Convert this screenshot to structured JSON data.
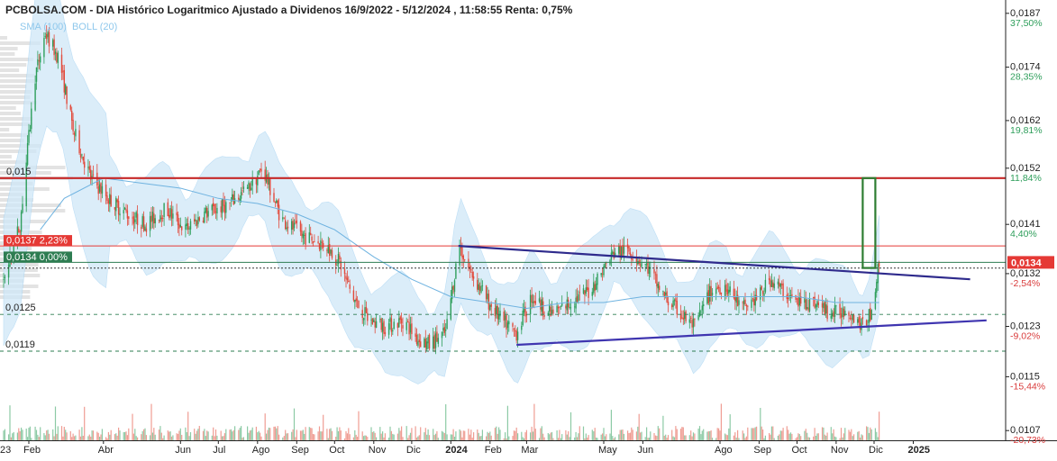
{
  "chart_data": {
    "type": "candlestick",
    "title": "PCBOLSA.COM - DIA Histórico Logaritmico Ajustado a Dividenos 16/9/2022 - 5/12/2024 , 11:58:55 Renta: 0,75%",
    "legend": [
      "SMA (100)",
      "BOLL (20)"
    ],
    "y_scale": "log",
    "ylim": [
      0.0106,
      0.0189
    ],
    "y_ticks": [
      {
        "value": 0.0187,
        "label": "0,0187",
        "pct": "37,50%"
      },
      {
        "value": 0.0174,
        "label": "0,0174",
        "pct": "28,35%"
      },
      {
        "value": 0.0162,
        "label": "0,0162",
        "pct": "19,81%"
      },
      {
        "value": 0.0152,
        "label": "0,0152",
        "pct": "11,84%"
      },
      {
        "value": 0.0141,
        "label": "0,0141",
        "pct": "4,40%"
      },
      {
        "value": 0.0132,
        "label": "0,0132",
        "pct": "-2,54%"
      },
      {
        "value": 0.0123,
        "label": "0,0123",
        "pct": "-9,02%"
      },
      {
        "value": 0.0115,
        "label": "0,0115",
        "pct": "-15,44%"
      },
      {
        "value": 0.0107,
        "label": "0,0107",
        "pct": "-20,73%"
      }
    ],
    "x_range": [
      "2023-01-12",
      "2025-03-08"
    ],
    "x_ticks": [
      {
        "date": "2023-01-02",
        "label": "23"
      },
      {
        "date": "2023-02-01",
        "label": "Feb"
      },
      {
        "date": "2023-04-01",
        "label": "Abr"
      },
      {
        "date": "2023-06-01",
        "label": "Jun"
      },
      {
        "date": "2023-07-01",
        "label": "Jul"
      },
      {
        "date": "2023-08-01",
        "label": "Ago"
      },
      {
        "date": "2023-09-01",
        "label": "Sep"
      },
      {
        "date": "2023-10-01",
        "label": "Oct"
      },
      {
        "date": "2023-11-01",
        "label": "Nov"
      },
      {
        "date": "2023-12-01",
        "label": "Dic"
      },
      {
        "date": "2024-01-01",
        "label": "2024"
      },
      {
        "date": "2024-02-01",
        "label": "Feb"
      },
      {
        "date": "2024-03-01",
        "label": "Mar"
      },
      {
        "date": "2024-05-01",
        "label": "May"
      },
      {
        "date": "2024-06-01",
        "label": "Jun"
      },
      {
        "date": "2024-08-01",
        "label": "Ago"
      },
      {
        "date": "2024-09-01",
        "label": "Sep"
      },
      {
        "date": "2024-10-01",
        "label": "Oct"
      },
      {
        "date": "2024-11-01",
        "label": "Nov"
      },
      {
        "date": "2024-12-01",
        "label": "Dic"
      },
      {
        "date": "2025-01-01",
        "label": "2025"
      }
    ],
    "price_path": [
      [
        "2023-01-12",
        0.0131
      ],
      [
        "2023-01-25",
        0.0141
      ],
      [
        "2023-02-06",
        0.0172
      ],
      [
        "2023-02-14",
        0.0182
      ],
      [
        "2023-02-25",
        0.0176
      ],
      [
        "2023-03-08",
        0.016
      ],
      [
        "2023-03-22",
        0.015
      ],
      [
        "2023-04-05",
        0.0146
      ],
      [
        "2023-04-20",
        0.0143
      ],
      [
        "2023-05-05",
        0.0141
      ],
      [
        "2023-05-20",
        0.0144
      ],
      [
        "2023-06-05",
        0.014
      ],
      [
        "2023-06-20",
        0.0143
      ],
      [
        "2023-07-10",
        0.0145
      ],
      [
        "2023-07-25",
        0.0148
      ],
      [
        "2023-08-05",
        0.0152
      ],
      [
        "2023-08-20",
        0.0142
      ],
      [
        "2023-09-05",
        0.0139
      ],
      [
        "2023-09-25",
        0.0137
      ],
      [
        "2023-10-05",
        0.0134
      ],
      [
        "2023-10-15",
        0.0128
      ],
      [
        "2023-10-28",
        0.0124
      ],
      [
        "2023-11-10",
        0.0123
      ],
      [
        "2023-11-25",
        0.0124
      ],
      [
        "2023-12-05",
        0.0121
      ],
      [
        "2023-12-15",
        0.012
      ],
      [
        "2023-12-28",
        0.0122
      ],
      [
        "2024-01-04",
        0.0132
      ],
      [
        "2024-01-08",
        0.0137
      ],
      [
        "2024-01-15",
        0.0133
      ],
      [
        "2024-01-28",
        0.0128
      ],
      [
        "2024-02-10",
        0.0124
      ],
      [
        "2024-02-22",
        0.0122
      ],
      [
        "2024-03-05",
        0.0128
      ],
      [
        "2024-03-20",
        0.0125
      ],
      [
        "2024-04-05",
        0.0127
      ],
      [
        "2024-04-20",
        0.0129
      ],
      [
        "2024-05-01",
        0.0133
      ],
      [
        "2024-05-10",
        0.0136
      ],
      [
        "2024-05-22",
        0.0136
      ],
      [
        "2024-06-05",
        0.0133
      ],
      [
        "2024-06-18",
        0.0128
      ],
      [
        "2024-07-01",
        0.0125
      ],
      [
        "2024-07-12",
        0.0123
      ],
      [
        "2024-07-25",
        0.0129
      ],
      [
        "2024-08-05",
        0.013
      ],
      [
        "2024-08-18",
        0.0126
      ],
      [
        "2024-09-01",
        0.0128
      ],
      [
        "2024-09-10",
        0.0131
      ],
      [
        "2024-09-20",
        0.0129
      ],
      [
        "2024-10-01",
        0.0127
      ],
      [
        "2024-10-15",
        0.0127
      ],
      [
        "2024-10-28",
        0.0125
      ],
      [
        "2024-11-10",
        0.0126
      ],
      [
        "2024-11-22",
        0.0123
      ],
      [
        "2024-11-28",
        0.0125
      ],
      [
        "2024-12-02",
        0.013
      ],
      [
        "2024-12-05",
        0.0134
      ]
    ],
    "sma_100": [
      [
        "2023-02-10",
        0.014
      ],
      [
        "2023-03-01",
        0.0146
      ],
      [
        "2023-04-01",
        0.015
      ],
      [
        "2023-05-01",
        0.0149
      ],
      [
        "2023-06-01",
        0.0148
      ],
      [
        "2023-07-01",
        0.0146
      ],
      [
        "2023-08-01",
        0.0145
      ],
      [
        "2023-09-01",
        0.0143
      ],
      [
        "2023-10-01",
        0.014
      ],
      [
        "2023-11-01",
        0.0135
      ],
      [
        "2023-12-01",
        0.0131
      ],
      [
        "2024-01-01",
        0.0128
      ],
      [
        "2024-02-01",
        0.0127
      ],
      [
        "2024-03-01",
        0.0126
      ],
      [
        "2024-04-01",
        0.0127
      ],
      [
        "2024-05-01",
        0.0127
      ],
      [
        "2024-06-01",
        0.0128
      ],
      [
        "2024-07-01",
        0.0128
      ],
      [
        "2024-08-01",
        0.0128
      ],
      [
        "2024-09-01",
        0.0128
      ],
      [
        "2024-10-01",
        0.0128
      ],
      [
        "2024-11-01",
        0.0127
      ],
      [
        "2024-12-05",
        0.0127
      ]
    ],
    "levels": [
      {
        "value": 0.015,
        "label": "0,015",
        "color": "#c62828",
        "style": "solid"
      },
      {
        "value": 0.0137,
        "label": "0,0137",
        "pct": "2,23%",
        "color": "#e53935",
        "style": "thin"
      },
      {
        "value": 0.0134,
        "label": "0,0134",
        "pct": "0,00%",
        "color": "#2e7d52",
        "style": "thin"
      },
      {
        "value": 0.0133,
        "label": "",
        "color": "#333333",
        "style": "dotted"
      },
      {
        "value": 0.0125,
        "label": "0,0125",
        "color": "#2e7d52",
        "style": "dashed"
      },
      {
        "value": 0.0119,
        "label": "0,0119",
        "color": "#2e7d52",
        "style": "dashed"
      }
    ],
    "current_price": {
      "label": "0,0134",
      "color": "#e53935"
    },
    "trendlines": [
      {
        "name": "resistance",
        "from": [
          "2024-01-07",
          0.0137
        ],
        "to": [
          "2025-02-15",
          0.0131
        ],
        "color": "#2e2a8c"
      },
      {
        "name": "support",
        "from": [
          "2024-02-22",
          0.012
        ],
        "to": [
          "2025-02-28",
          0.0124
        ],
        "color": "#3f35b0"
      }
    ],
    "target_box": {
      "from": [
        "2024-11-22",
        0.0133
      ],
      "to": [
        "2024-12-02",
        0.015
      ],
      "color": "#2e7d32"
    },
    "colors": {
      "up": "#2e9e5b",
      "down": "#e24a3b",
      "bollinger": "#cfe7f8",
      "sma": "#6fb3e0",
      "volume_profile": "#dcdcdc"
    }
  }
}
